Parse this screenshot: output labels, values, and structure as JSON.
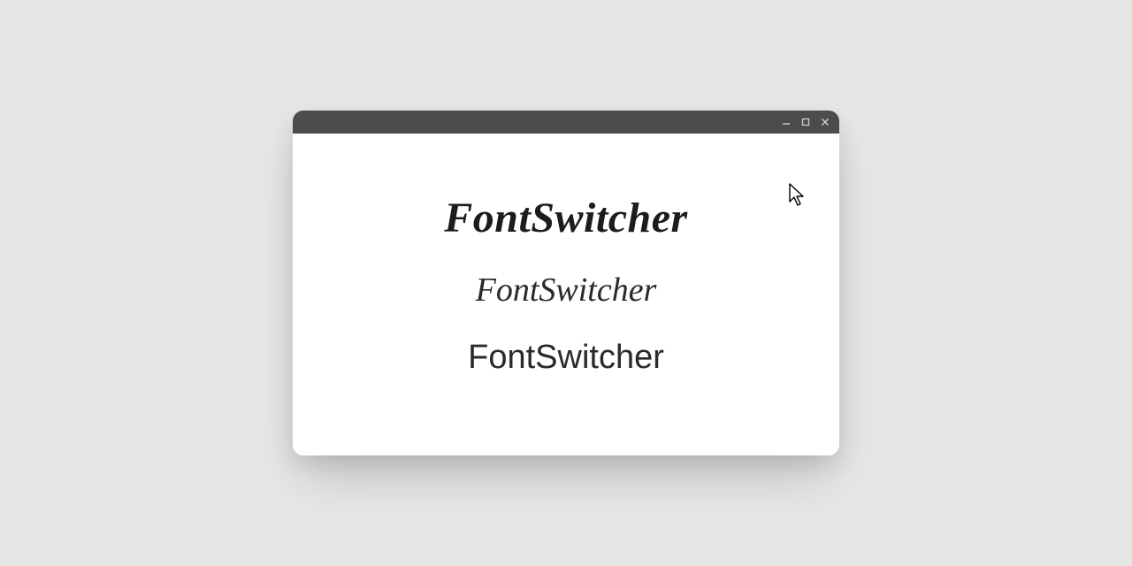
{
  "samples": {
    "line1": "FontSwitcher",
    "line2": "FontSwitcher",
    "line3": "FontSwitcher"
  },
  "window_controls": {
    "minimize": "minimize",
    "maximize": "maximize",
    "close": "close"
  }
}
